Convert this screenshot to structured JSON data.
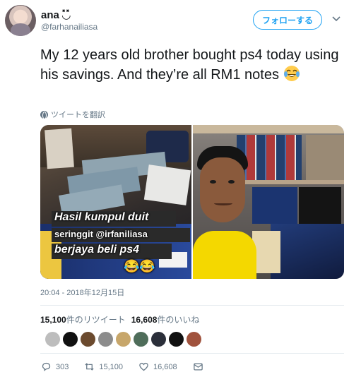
{
  "user": {
    "display_name": "ana ◟̽◞̽",
    "handle": "@farhanailiasa",
    "follow_label": "フォローする"
  },
  "tweet": {
    "text": "My 12 years old brother bought ps4 today using his savings. And they’re all RM1 notes",
    "emoji": "face-with-tears-of-joy",
    "translate_label": "ツイートを翻訳"
  },
  "media": {
    "overlay_line1": "Hasil kumpul duit",
    "overlay_line2": "seringgit @irfaniliasa",
    "overlay_line3": "berjaya beli ps4",
    "overlay_emoji": "😂😂"
  },
  "timestamp": "20:04 - 2018年12月15日",
  "stats": {
    "retweets": "15,100",
    "retweets_label": "件のリツイート",
    "likes": "16,608",
    "likes_label": "件のいいね"
  },
  "likers": [
    {
      "color": "#bdbdbd"
    },
    {
      "color": "#111111"
    },
    {
      "color": "#6b4a2e"
    },
    {
      "color": "#8c8c8c"
    },
    {
      "color": "#c7a66a"
    },
    {
      "color": "#4f6d5a"
    },
    {
      "color": "#2b2f3a"
    },
    {
      "color": "#101010"
    },
    {
      "color": "#a0523d"
    }
  ],
  "actions": {
    "replies": "303",
    "retweets": "15,100",
    "likes": "16,608"
  },
  "colors": {
    "accent": "#1da1f2",
    "muted": "#657786"
  }
}
